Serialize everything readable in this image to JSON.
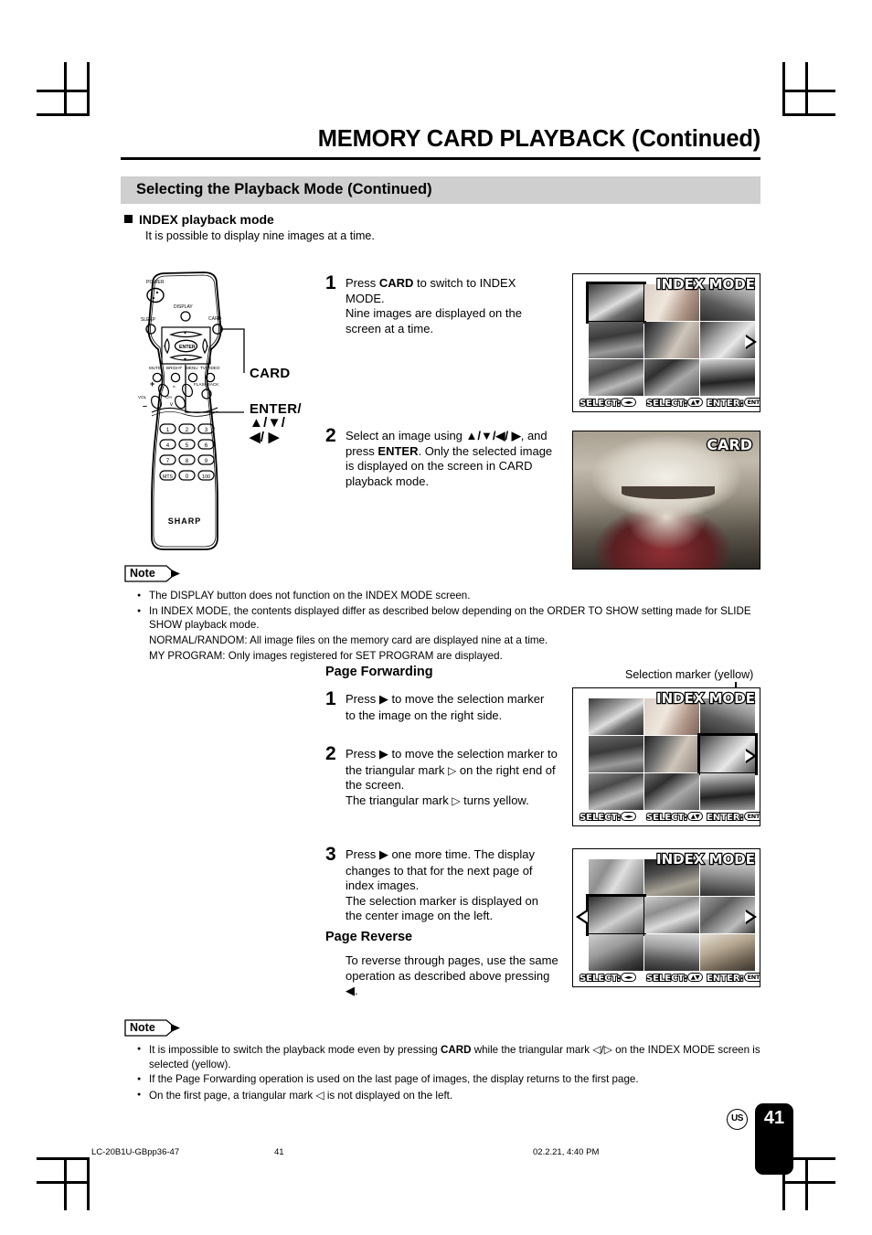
{
  "header": {
    "title": "MEMORY CARD PLAYBACK (Continued)",
    "section_bar": "Selecting the Playback Mode (Continued)",
    "subhead": "INDEX playback mode",
    "subtext": "It is possible to display nine images at a time."
  },
  "remote": {
    "brand": "SHARP",
    "buttons": {
      "power": "POWER",
      "display": "DISPLAY",
      "sleep": "SLEEP",
      "card": "CARD",
      "enter": "ENTER",
      "mute": "MUTE",
      "bright": "BRIGHT",
      "menu": "MENU",
      "tvvideo": "TV/VIDEO",
      "flashback": "FLASHBACK",
      "vol": "VOL",
      "ch": "CH",
      "vol_plus": "+",
      "vol_minus": "–"
    },
    "keypad": [
      "1",
      "2",
      "3",
      "4",
      "5",
      "6",
      "7",
      "8",
      "9",
      "MTS",
      "0",
      "100"
    ],
    "callouts": {
      "card": "CARD",
      "enter_line1": "ENTER/",
      "enter_line2": "▲/▼/",
      "enter_line3": "◀/ ▶"
    }
  },
  "steps_main": [
    {
      "num": "1",
      "html": "Press <b>CARD</b> to switch to INDEX MODE.<br>Nine images are displayed on the screen at a time."
    },
    {
      "num": "2",
      "html": "Select an image using <b>▲/▼/◀/ ▶</b>, and press <b>ENTER</b>. Only the selected image is displayed on the screen in CARD playback mode."
    }
  ],
  "screens": {
    "index_title": "INDEX MODE",
    "card_title": "CARD",
    "osd_select": "SELECT:",
    "osd_enter": "ENTER:",
    "osd_enter_pill": "ENTER"
  },
  "note_top": {
    "badge": "Note",
    "items": [
      {
        "text": "The DISPLAY button does not function on the INDEX MODE screen.",
        "sub": false
      },
      {
        "text": "In INDEX MODE, the contents displayed differ as described below depending on the ORDER TO SHOW setting made for SLIDE SHOW playback mode.",
        "sub": false
      },
      {
        "text": "NORMAL/RANDOM: All image files on the memory card are displayed nine at a time.",
        "sub": true
      },
      {
        "text": "MY PROGRAM: Only images registered for SET PROGRAM are displayed.",
        "sub": true
      }
    ]
  },
  "page_forwarding": {
    "heading": "Page Forwarding",
    "marker_label": "Selection marker (yellow)",
    "steps": [
      {
        "num": "1",
        "html": "Press <span class=\"arrow-g\">▶</span> to move the selection marker to the image on the right side."
      },
      {
        "num": "2",
        "html": "Press <span class=\"arrow-g\">▶</span> to move the selection marker to the triangular mark <span class=\"ohollow\">▷</span> on the right end of the screen.<br>The triangular mark <span class=\"ohollow\">▷</span> turns yellow."
      },
      {
        "num": "3",
        "html": "Press <span class=\"arrow-g\">▶</span> one more time. The display changes to that for the next page of index images.<br>The selection marker is displayed on the center image on the left."
      }
    ]
  },
  "page_reverse": {
    "heading": "Page Reverse",
    "body": "To reverse through pages, use the same operation as described above pressing ◀."
  },
  "note_bottom": {
    "badge": "Note",
    "items": [
      {
        "html": "It is impossible to switch the playback mode even by pressing <b>CARD</b> while the triangular mark <span class=\"ohollow\">◁</span>/<span class=\"ohollow\">▷</span> on the INDEX MODE screen is selected (yellow).",
        "sub": false
      },
      {
        "html": "If the Page Forwarding operation is used on the last page of images, the display returns to the first page.",
        "sub": false
      },
      {
        "html": "On the first page, a triangular mark <span class=\"ohollow\">◁</span> is not displayed on the left.",
        "sub": false
      }
    ]
  },
  "footer": {
    "doc_id": "LC-20B1U-GBpp36-47",
    "page_mid": "41",
    "timestamp": "02.2.21, 4:40 PM",
    "region_badge": "US",
    "page_number": "41"
  }
}
